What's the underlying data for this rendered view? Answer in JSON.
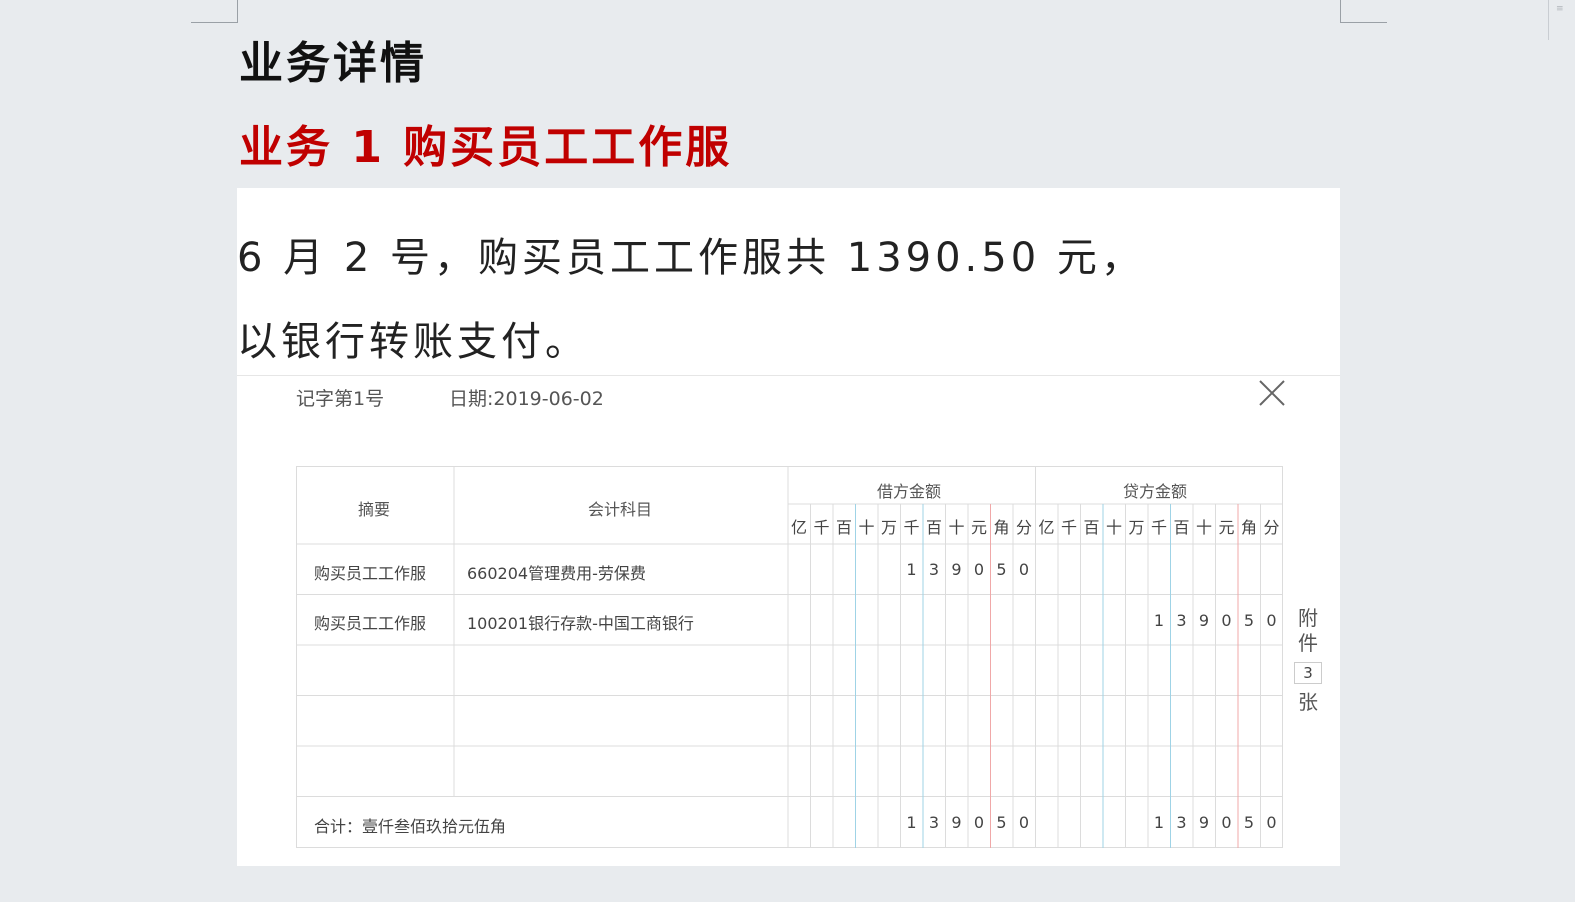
{
  "page": {
    "title": "业务详情",
    "subtitle": "业务 1 购买员工工作服",
    "description_line1": "6 月 2 号，购买员工工作服共 1390.50 元，",
    "description_line2": "以银行转账支付。"
  },
  "voucher": {
    "number": "记字第1号",
    "date_label": "日期:2019-06-02",
    "close_icon": "close-icon",
    "headers": {
      "summary": "摘要",
      "account": "会计科目",
      "debit": "借方金额",
      "credit": "贷方金额",
      "digit_units": [
        "亿",
        "千",
        "百",
        "十",
        "万",
        "千",
        "百",
        "十",
        "元",
        "角",
        "分"
      ]
    },
    "rows": [
      {
        "summary": "购买员工工作服",
        "account": "660204管理费用-劳保费",
        "debit": "139050",
        "credit": ""
      },
      {
        "summary": "购买员工工作服",
        "account": "100201银行存款-中国工商银行",
        "debit": "",
        "credit": "139050"
      },
      {
        "summary": "",
        "account": "",
        "debit": "",
        "credit": ""
      },
      {
        "summary": "",
        "account": "",
        "debit": "",
        "credit": ""
      },
      {
        "summary": "",
        "account": "",
        "debit": "",
        "credit": ""
      }
    ],
    "total": {
      "label": "合计：壹仟叁佰玖拾元伍角",
      "debit": "139050",
      "credit": "139050"
    },
    "attachment": {
      "label_top": "附",
      "label_mid": "件",
      "count": "3",
      "label_bottom": "张"
    },
    "colors": {
      "thousand_sep": "#9fd3e6",
      "yuan_sep": "#f0a8a8",
      "grid_line": "#dcdcdc"
    }
  }
}
